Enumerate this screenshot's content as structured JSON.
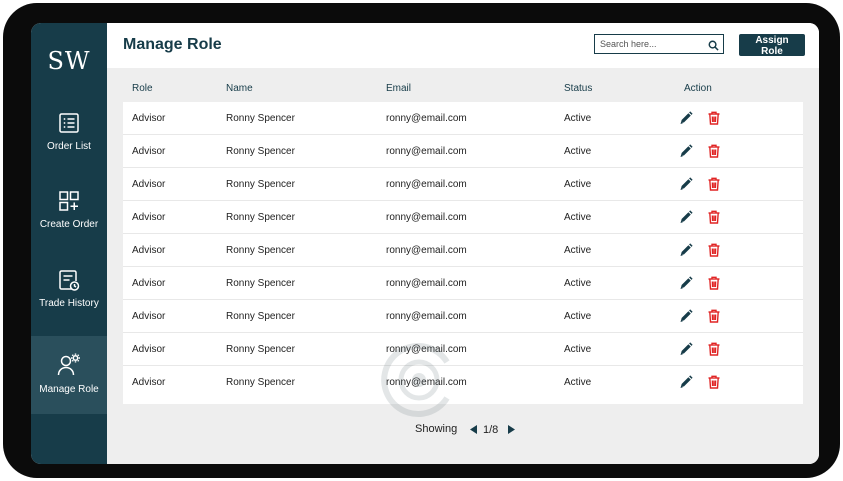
{
  "app": {
    "logo": "SW"
  },
  "sidebar": {
    "items": [
      {
        "label": "Order List",
        "icon": "list-icon",
        "active": false
      },
      {
        "label": "Create Order",
        "icon": "grid-plus-icon",
        "active": false
      },
      {
        "label": "Trade History",
        "icon": "history-icon",
        "active": false
      },
      {
        "label": "Manage Role",
        "icon": "user-gear-icon",
        "active": true
      }
    ]
  },
  "header": {
    "title": "Manage Role",
    "search_placeholder": "Search here...",
    "assign_button": "Assign Role"
  },
  "table": {
    "columns": [
      "Role",
      "Name",
      "Email",
      "Status",
      "Action"
    ],
    "rows": [
      {
        "role": "Advisor",
        "name": "Ronny Spencer",
        "email": "ronny@email.com",
        "status": "Active"
      },
      {
        "role": "Advisor",
        "name": "Ronny Spencer",
        "email": "ronny@email.com",
        "status": "Active"
      },
      {
        "role": "Advisor",
        "name": "Ronny Spencer",
        "email": "ronny@email.com",
        "status": "Active"
      },
      {
        "role": "Advisor",
        "name": "Ronny Spencer",
        "email": "ronny@email.com",
        "status": "Active"
      },
      {
        "role": "Advisor",
        "name": "Ronny Spencer",
        "email": "ronny@email.com",
        "status": "Active"
      },
      {
        "role": "Advisor",
        "name": "Ronny Spencer",
        "email": "ronny@email.com",
        "status": "Active"
      },
      {
        "role": "Advisor",
        "name": "Ronny Spencer",
        "email": "ronny@email.com",
        "status": "Active"
      },
      {
        "role": "Advisor",
        "name": "Ronny Spencer",
        "email": "ronny@email.com",
        "status": "Active"
      },
      {
        "role": "Advisor",
        "name": "Ronny Spencer",
        "email": "ronny@email.com",
        "status": "Active"
      }
    ]
  },
  "pagination": {
    "label": "Showing",
    "page": "1/8"
  },
  "colors": {
    "primary": "#173c49",
    "delete": "#e02424",
    "edit": "#173c49",
    "background": "#eeeeee"
  }
}
